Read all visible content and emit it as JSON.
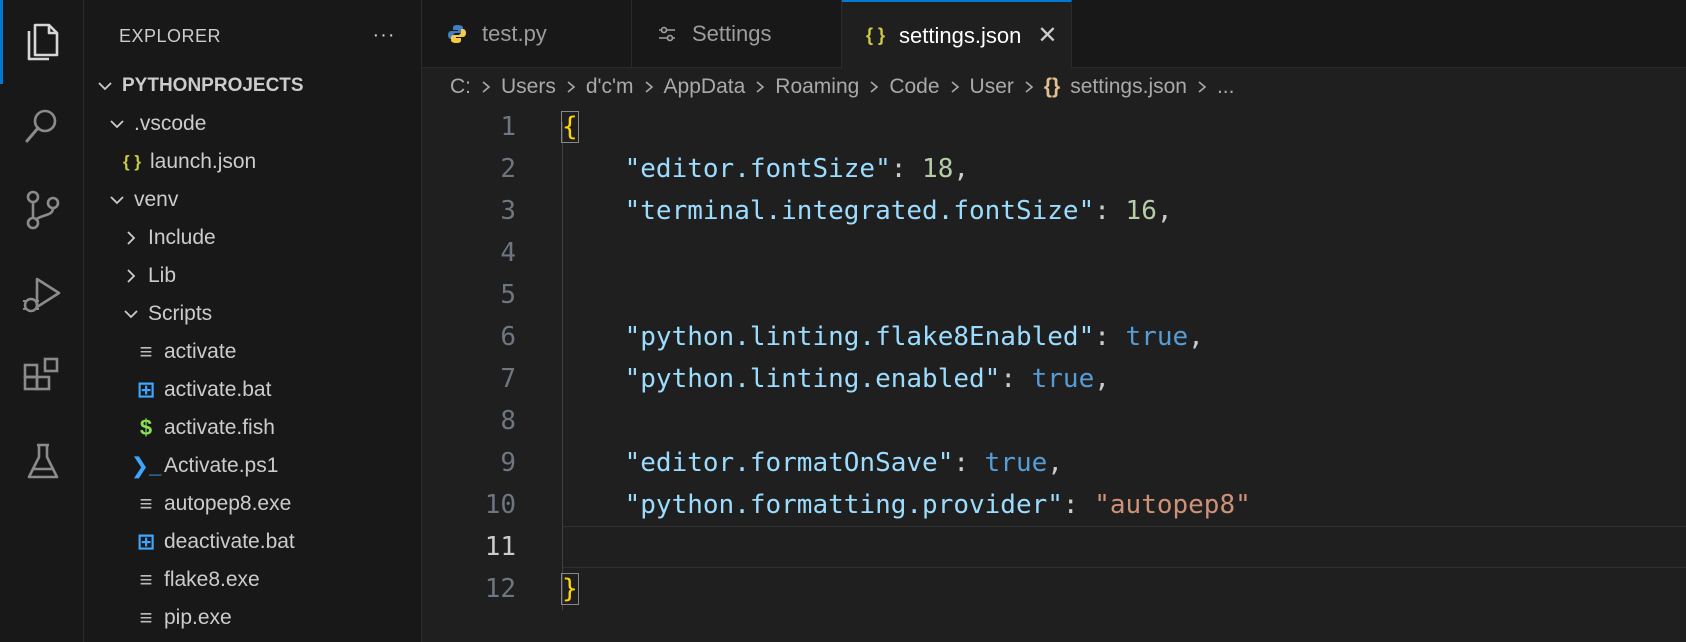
{
  "activity_bar": {
    "items": [
      {
        "icon": "files-icon",
        "active": true
      },
      {
        "icon": "search-icon"
      },
      {
        "icon": "source-control-icon"
      },
      {
        "icon": "run-debug-icon"
      },
      {
        "icon": "extensions-icon"
      },
      {
        "icon": "testing-icon"
      }
    ]
  },
  "sidebar": {
    "title": "EXPLORER",
    "more": "···",
    "tree": [
      {
        "label": "PYTHONPROJECTS",
        "type": "root",
        "expanded": true,
        "level": 0
      },
      {
        "label": ".vscode",
        "type": "folder",
        "expanded": true,
        "level": 1
      },
      {
        "label": "launch.json",
        "type": "json",
        "level": 2
      },
      {
        "label": "venv",
        "type": "folder",
        "expanded": true,
        "level": 1
      },
      {
        "label": "Include",
        "type": "folder",
        "expanded": false,
        "level": 2
      },
      {
        "label": "Lib",
        "type": "folder",
        "expanded": false,
        "level": 2
      },
      {
        "label": "Scripts",
        "type": "folder",
        "expanded": true,
        "level": 2
      },
      {
        "label": "activate",
        "type": "text",
        "level": 3
      },
      {
        "label": "activate.bat",
        "type": "windows",
        "level": 3
      },
      {
        "label": "activate.fish",
        "type": "shell",
        "level": 3
      },
      {
        "label": "Activate.ps1",
        "type": "powershell",
        "level": 3
      },
      {
        "label": "autopep8.exe",
        "type": "text",
        "level": 3
      },
      {
        "label": "deactivate.bat",
        "type": "windows",
        "level": 3
      },
      {
        "label": "flake8.exe",
        "type": "text",
        "level": 3
      },
      {
        "label": "pip.exe",
        "type": "text",
        "level": 3
      }
    ]
  },
  "tabs": [
    {
      "label": "test.py",
      "icon": "python-icon",
      "active": false
    },
    {
      "label": "Settings",
      "icon": "settings-sliders-icon",
      "active": false
    },
    {
      "label": "settings.json",
      "icon": "json-icon",
      "active": true,
      "close": "✕"
    }
  ],
  "breadcrumb": {
    "parts": [
      "C:",
      "Users",
      "d'c'm",
      "AppData",
      "Roaming",
      "Code",
      "User"
    ],
    "file_icon": "{}",
    "file": "settings.json",
    "tail": "..."
  },
  "editor": {
    "current_line": 11,
    "lines": [
      {
        "n": "1",
        "tokens": [
          {
            "t": "{",
            "c": "brace"
          }
        ]
      },
      {
        "n": "2",
        "tokens": [
          {
            "t": "    ",
            "c": "punc"
          },
          {
            "t": "\"editor.fontSize\"",
            "c": "key"
          },
          {
            "t": ": ",
            "c": "punc"
          },
          {
            "t": "18",
            "c": "num"
          },
          {
            "t": ",",
            "c": "punc"
          }
        ]
      },
      {
        "n": "3",
        "tokens": [
          {
            "t": "    ",
            "c": "punc"
          },
          {
            "t": "\"terminal.integrated.fontSize\"",
            "c": "key"
          },
          {
            "t": ": ",
            "c": "punc"
          },
          {
            "t": "16",
            "c": "num"
          },
          {
            "t": ",",
            "c": "punc"
          }
        ]
      },
      {
        "n": "4",
        "tokens": []
      },
      {
        "n": "5",
        "tokens": []
      },
      {
        "n": "6",
        "tokens": [
          {
            "t": "    ",
            "c": "punc"
          },
          {
            "t": "\"python.linting.flake8Enabled\"",
            "c": "key"
          },
          {
            "t": ": ",
            "c": "punc"
          },
          {
            "t": "true",
            "c": "bool"
          },
          {
            "t": ",",
            "c": "punc"
          }
        ]
      },
      {
        "n": "7",
        "tokens": [
          {
            "t": "    ",
            "c": "punc"
          },
          {
            "t": "\"python.linting.enabled\"",
            "c": "key"
          },
          {
            "t": ": ",
            "c": "punc"
          },
          {
            "t": "true",
            "c": "bool"
          },
          {
            "t": ",",
            "c": "punc"
          }
        ]
      },
      {
        "n": "8",
        "tokens": []
      },
      {
        "n": "9",
        "tokens": [
          {
            "t": "    ",
            "c": "punc"
          },
          {
            "t": "\"editor.formatOnSave\"",
            "c": "key"
          },
          {
            "t": ": ",
            "c": "punc"
          },
          {
            "t": "true",
            "c": "bool"
          },
          {
            "t": ",",
            "c": "punc"
          }
        ]
      },
      {
        "n": "10",
        "tokens": [
          {
            "t": "    ",
            "c": "punc"
          },
          {
            "t": "\"python.formatting.provider\"",
            "c": "key"
          },
          {
            "t": ": ",
            "c": "punc"
          },
          {
            "t": "\"autopep8\"",
            "c": "str"
          }
        ]
      },
      {
        "n": "11",
        "tokens": []
      },
      {
        "n": "12",
        "tokens": [
          {
            "t": "}",
            "c": "brace"
          }
        ]
      }
    ]
  },
  "colors": {
    "accent": "#0078d4",
    "key": "#9cdcfe",
    "number": "#b5cea8",
    "boolean": "#569cd6",
    "string": "#ce9178",
    "brace": "#ffd700"
  }
}
